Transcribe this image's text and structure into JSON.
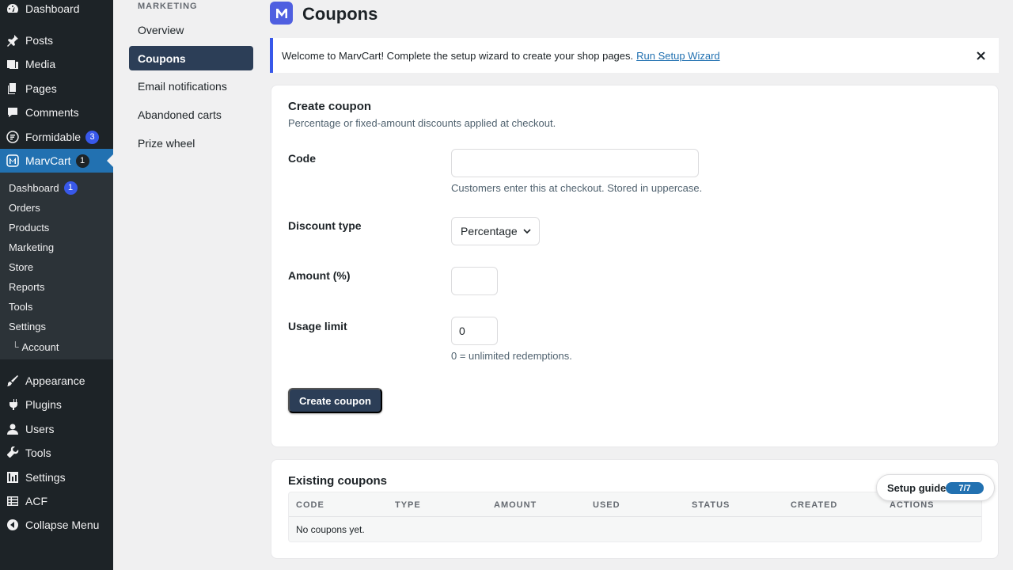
{
  "admin_menu": {
    "items": [
      {
        "label": "Dashboard",
        "icon": "dashboard-icon"
      },
      {
        "label": "Posts",
        "icon": "pin-icon"
      },
      {
        "label": "Media",
        "icon": "media-icon"
      },
      {
        "label": "Pages",
        "icon": "pages-icon"
      },
      {
        "label": "Comments",
        "icon": "comment-icon"
      },
      {
        "label": "Formidable",
        "icon": "formidable-icon",
        "badge": "3"
      },
      {
        "label": "MarvCart",
        "icon": "marvcart-icon",
        "badge": "1"
      },
      {
        "label": "Appearance",
        "icon": "brush-icon"
      },
      {
        "label": "Plugins",
        "icon": "plugin-icon"
      },
      {
        "label": "Users",
        "icon": "user-icon"
      },
      {
        "label": "Tools",
        "icon": "wrench-icon"
      },
      {
        "label": "Settings",
        "icon": "settings-icon"
      },
      {
        "label": "ACF",
        "icon": "grid-icon"
      },
      {
        "label": "Collapse Menu",
        "icon": "collapse-icon"
      }
    ],
    "submenu": [
      {
        "label": "Dashboard",
        "badge": "1"
      },
      {
        "label": "Orders"
      },
      {
        "label": "Products"
      },
      {
        "label": "Marketing"
      },
      {
        "label": "Store"
      },
      {
        "label": "Reports"
      },
      {
        "label": "Tools"
      },
      {
        "label": "Settings"
      },
      {
        "label": "Account",
        "prefix": "└"
      }
    ]
  },
  "subnav": {
    "heading": "MARKETING",
    "items": [
      "Overview",
      "Coupons",
      "Email notifications",
      "Abandoned carts",
      "Prize wheel"
    ]
  },
  "header": {
    "logo_letter": "M",
    "title": "Coupons"
  },
  "notice": {
    "text": "Welcome to MarvCart! Complete the setup wizard to create your shop pages.",
    "link": "Run Setup Wizard"
  },
  "create_coupon": {
    "title": "Create coupon",
    "subtitle": "Percentage or fixed-amount discounts applied at checkout.",
    "code": {
      "label": "Code",
      "value": "",
      "help": "Customers enter this at checkout. Stored in uppercase."
    },
    "discount_type": {
      "label": "Discount type",
      "value": "Percentage"
    },
    "amount": {
      "label": "Amount (%)",
      "value": ""
    },
    "usage_limit": {
      "label": "Usage limit",
      "value": "0",
      "help": "0 = unlimited redemptions."
    },
    "submit": "Create coupon"
  },
  "existing": {
    "title": "Existing coupons",
    "columns": [
      "CODE",
      "TYPE",
      "AMOUNT",
      "USED",
      "STATUS",
      "CREATED",
      "ACTIONS"
    ],
    "empty": "No coupons yet."
  },
  "setup_guide": {
    "label": "Setup guide",
    "progress": "7/7"
  },
  "colors": {
    "wp_sidebar": "#1d2327",
    "wp_blue": "#2271b1",
    "accent": "#2c3e57",
    "brand": "#4f5fe0"
  }
}
